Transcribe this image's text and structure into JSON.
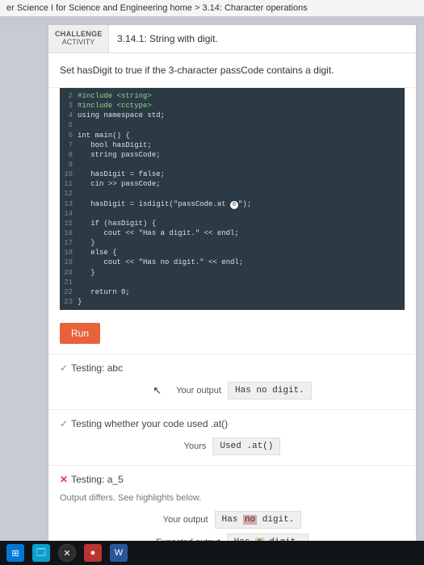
{
  "breadcrumb": "er Science I for Science and Engineering home > 3.14: Character operations",
  "challenge": {
    "label1": "CHALLENGE",
    "label2": "ACTIVITY",
    "title": "3.14.1: String with digit."
  },
  "instruction": "Set hasDigit to true if the 3-character passCode contains a digit.",
  "code": {
    "l2": "#include <string>",
    "l3": "#include <cctype>",
    "l4": "using namespace std;",
    "l5": "",
    "l6": "int main() {",
    "l7": "   bool hasDigit;",
    "l8": "   string passCode;",
    "l9": "",
    "l10": "   hasDigit = false;",
    "l11": "   cin >> passCode;",
    "l12": "",
    "l13a": "   hasDigit = isdigit(\"passCode.at ",
    "l13b": "\");",
    "l14": "",
    "l15": "   if (hasDigit) {",
    "l16": "      cout << \"Has a digit.\" << endl;",
    "l17": "   }",
    "l18": "   else {",
    "l19": "      cout << \"Has no digit.\" << endl;",
    "l20": "   }",
    "l21": "",
    "l22": "   return 0;",
    "l23": "}"
  },
  "run_label": "Run",
  "tests": {
    "t1": {
      "title": "Testing: abc",
      "your_label": "Your output",
      "your_val": "Has no digit."
    },
    "t2": {
      "title": "Testing whether your code used .at()",
      "yours_label": "Yours",
      "yours_val": "Used .at()"
    },
    "t3": {
      "title": "Testing: a_5",
      "sub": "Output differs. See highlights below.",
      "your_label": "Your output",
      "your_pre": "Has ",
      "your_diff": "no",
      "your_post": " digit.",
      "exp_label": "Expected output",
      "exp_pre": "Has ",
      "exp_diff": "a",
      "exp_post": " digit."
    }
  },
  "cursor_badge": "0"
}
